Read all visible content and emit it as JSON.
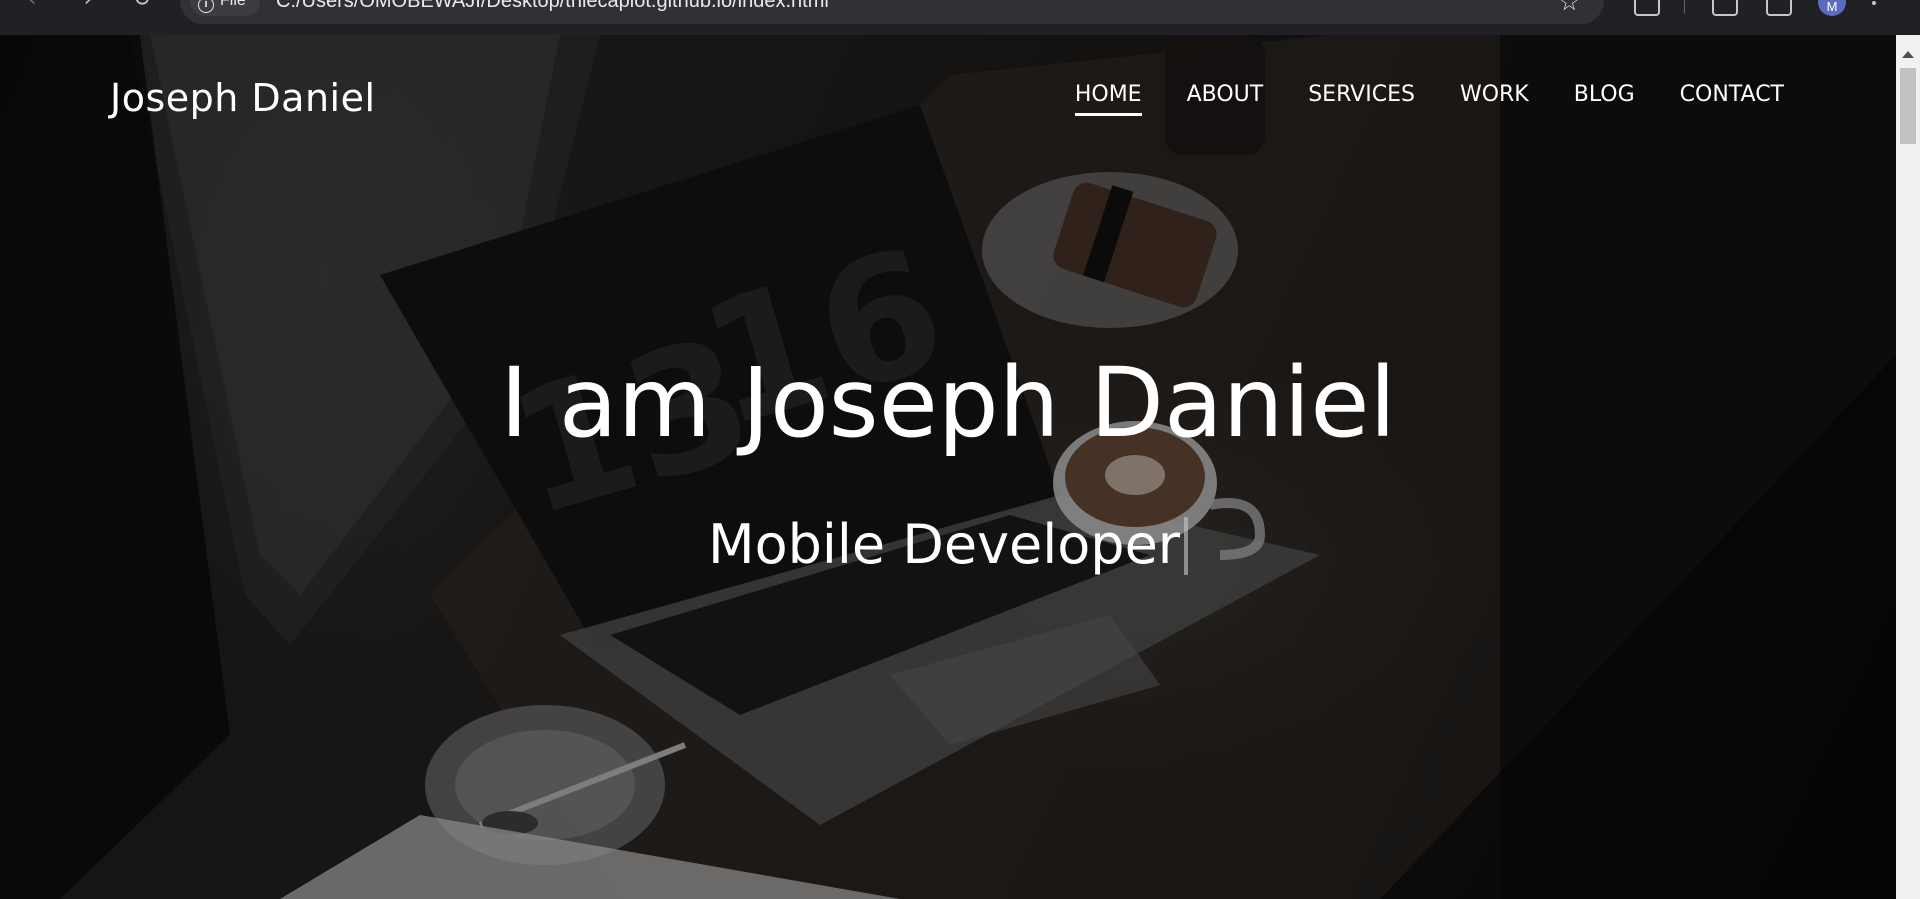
{
  "browser": {
    "site_chip_label": "File",
    "url": "C:/Users/OMOBEWAJI/Desktop/thiecapiot.github.io/index.html",
    "avatar_initial": "M"
  },
  "site": {
    "brand": "Joseph Daniel",
    "nav": [
      {
        "label": "HOME",
        "active": true
      },
      {
        "label": "ABOUT"
      },
      {
        "label": "SERVICES"
      },
      {
        "label": "WORK"
      },
      {
        "label": "BLOG"
      },
      {
        "label": "CONTACT"
      }
    ]
  },
  "hero": {
    "title": "I am Joseph Daniel",
    "subtitle": "Mobile Developer"
  }
}
